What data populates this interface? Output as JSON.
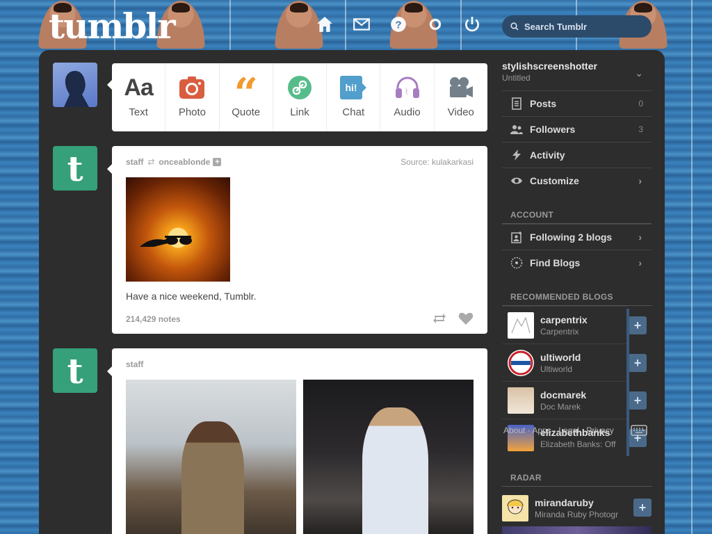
{
  "header": {
    "logo": "tumblr",
    "search_placeholder": "Search Tumblr",
    "nav_icons": [
      "home-icon",
      "mail-icon",
      "help-icon",
      "settings-icon",
      "power-icon"
    ]
  },
  "post_types": [
    {
      "label": "Text",
      "icon": "text-icon",
      "color": "#444444"
    },
    {
      "label": "Photo",
      "icon": "camera-icon",
      "color": "#d95e40"
    },
    {
      "label": "Quote",
      "icon": "quote-icon",
      "color": "#f2992e"
    },
    {
      "label": "Link",
      "icon": "link-icon",
      "color": "#56bc8a"
    },
    {
      "label": "Chat",
      "icon": "chat-icon",
      "color": "#529ecc"
    },
    {
      "label": "Audio",
      "icon": "audio-icon",
      "color": "#a77dc2"
    },
    {
      "label": "Video",
      "icon": "video-icon",
      "color": "#748089"
    }
  ],
  "posts": [
    {
      "author": "staff",
      "reblogged_from": "onceablonde",
      "source_label": "Source:",
      "source": "kulakarkasi",
      "caption": "Have a nice weekend, Tumblr.",
      "notes": "214,429 notes"
    },
    {
      "author": "staff"
    }
  ],
  "sidebar": {
    "blog_name": "stylishscreenshotter",
    "blog_title": "Untitled",
    "items": [
      {
        "label": "Posts",
        "count": "0",
        "icon": "posts-icon"
      },
      {
        "label": "Followers",
        "count": "3",
        "icon": "followers-icon"
      },
      {
        "label": "Activity",
        "icon": "activity-icon"
      },
      {
        "label": "Customize",
        "icon": "eye-icon"
      }
    ],
    "account_heading": "ACCOUNT",
    "account_items": [
      {
        "label": "Following 2 blogs",
        "icon": "following-icon"
      },
      {
        "label": "Find Blogs",
        "icon": "compass-icon"
      }
    ],
    "recommended_heading": "RECOMMENDED BLOGS",
    "recommended": [
      {
        "name": "carpentrix",
        "title": "Carpentrix"
      },
      {
        "name": "ultiworld",
        "title": "Ultiworld"
      },
      {
        "name": "docmarek",
        "title": "Doc Marek"
      },
      {
        "name": "elizabethbanks",
        "title": "Elizabeth Banks: Off"
      }
    ],
    "overlay_text": "About · Apps · Legal · Privacy",
    "radar_heading": "RADAR",
    "radar": {
      "name": "mirandaruby",
      "title": "Miranda Ruby Photogr"
    }
  }
}
